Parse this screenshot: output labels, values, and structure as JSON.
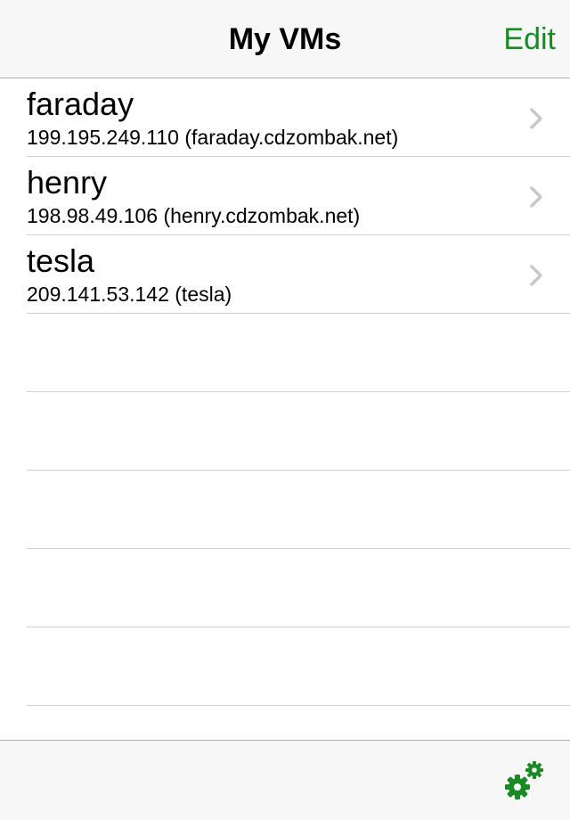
{
  "nav": {
    "title": "My VMs",
    "edit_label": "Edit"
  },
  "colors": {
    "accent": "#1a8a24",
    "chevron": "#c7c7cc",
    "separator": "#cfcfd3",
    "bar_background": "#f7f7f7"
  },
  "vms": [
    {
      "name": "faraday",
      "detail": "199.195.249.110 (faraday.cdzombak.net)"
    },
    {
      "name": "henry",
      "detail": "198.98.49.106 (henry.cdzombak.net)"
    },
    {
      "name": "tesla",
      "detail": "209.141.53.142 (tesla)"
    }
  ],
  "toolbar": {
    "settings_icon": "gears-icon"
  }
}
